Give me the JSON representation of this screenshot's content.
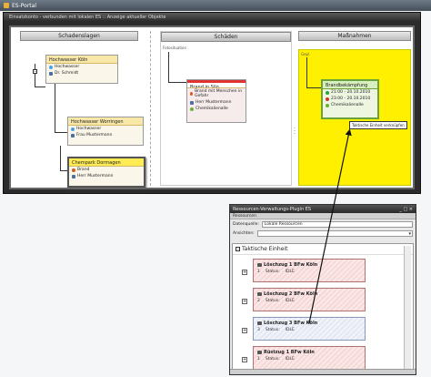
{
  "app": {
    "title": "ES-Portal"
  },
  "main_window": {
    "title": "Einsatzkonto - verbunden mit lokalen ES :: Anzeige aktueller Objekte"
  },
  "columns": {
    "damage": {
      "header": "Schadenslagen",
      "cards": [
        {
          "title": "Hochwasser Köln",
          "rows": [
            {
              "icon": "flood-icon",
              "text": "Hochwasser"
            },
            {
              "icon": "person-icon",
              "text": "Dr. Schmidt"
            }
          ]
        },
        {
          "title": "Hochwasser Worringen",
          "rows": [
            {
              "icon": "flood-icon",
              "text": "Hochwasser"
            },
            {
              "icon": "person-icon",
              "text": "Frau Mustermann"
            }
          ]
        },
        {
          "title": "Chempark Dormagen",
          "rows": [
            {
              "icon": "fire-icon",
              "text": "Brand"
            },
            {
              "icon": "person-icon",
              "text": "Herr Mustermann"
            }
          ]
        }
      ]
    },
    "losses": {
      "header": "Schäden",
      "sublabel": "Fotosituation",
      "cards": [
        {
          "title": "Brand in Silo",
          "rows": [
            {
              "icon": "fire-icon",
              "text": "Brand mit Menschen in Gefahr"
            },
            {
              "icon": "person-icon",
              "text": "Herr Mustermann"
            },
            {
              "icon": "chemical-icon",
              "text": "Chemikalienalle"
            }
          ]
        }
      ]
    },
    "measures": {
      "header": "Maßnahmen",
      "sublabel": "Gepl.",
      "cards": [
        {
          "title": "Brandbekämpfung",
          "rows": [
            {
              "icon": "clock-green-icon",
              "text": "21:00 - 20.10.2010"
            },
            {
              "icon": "clock-red-icon",
              "text": "23:00 - 20.10.2010"
            },
            {
              "icon": "chemical-icon",
              "text": "Chemikalienalle"
            }
          ]
        }
      ],
      "tooltip": "Taktische Einheit verknüpfen"
    }
  },
  "plugin_window": {
    "title": "Ressourcen-Verwaltungs-Plugin ES",
    "title_controls": "_ □ ×",
    "menu": "Ressourcen",
    "fields": [
      {
        "label": "Datenquelle:",
        "value": "Lokale Ressourcen"
      },
      {
        "label": "Ansichten:",
        "value": ""
      }
    ],
    "tree_root": "Taktische Einheit",
    "units": [
      {
        "title": "Löschzug 1 BFw Köln",
        "status_label": "Status:",
        "status_value": "IDLE",
        "number": "1"
      },
      {
        "title": "Löschzug 2 BFw Köln",
        "status_label": "Status:",
        "status_value": "IDLE",
        "number": "2"
      },
      {
        "title": "Löschzug 3 BFw Köln",
        "status_label": "Status:",
        "status_value": "IDLE",
        "number": "3"
      },
      {
        "title": "Rüstzug 1 BFw Köln",
        "status_label": "Status:",
        "status_value": "IDLE",
        "number": "1"
      }
    ]
  }
}
